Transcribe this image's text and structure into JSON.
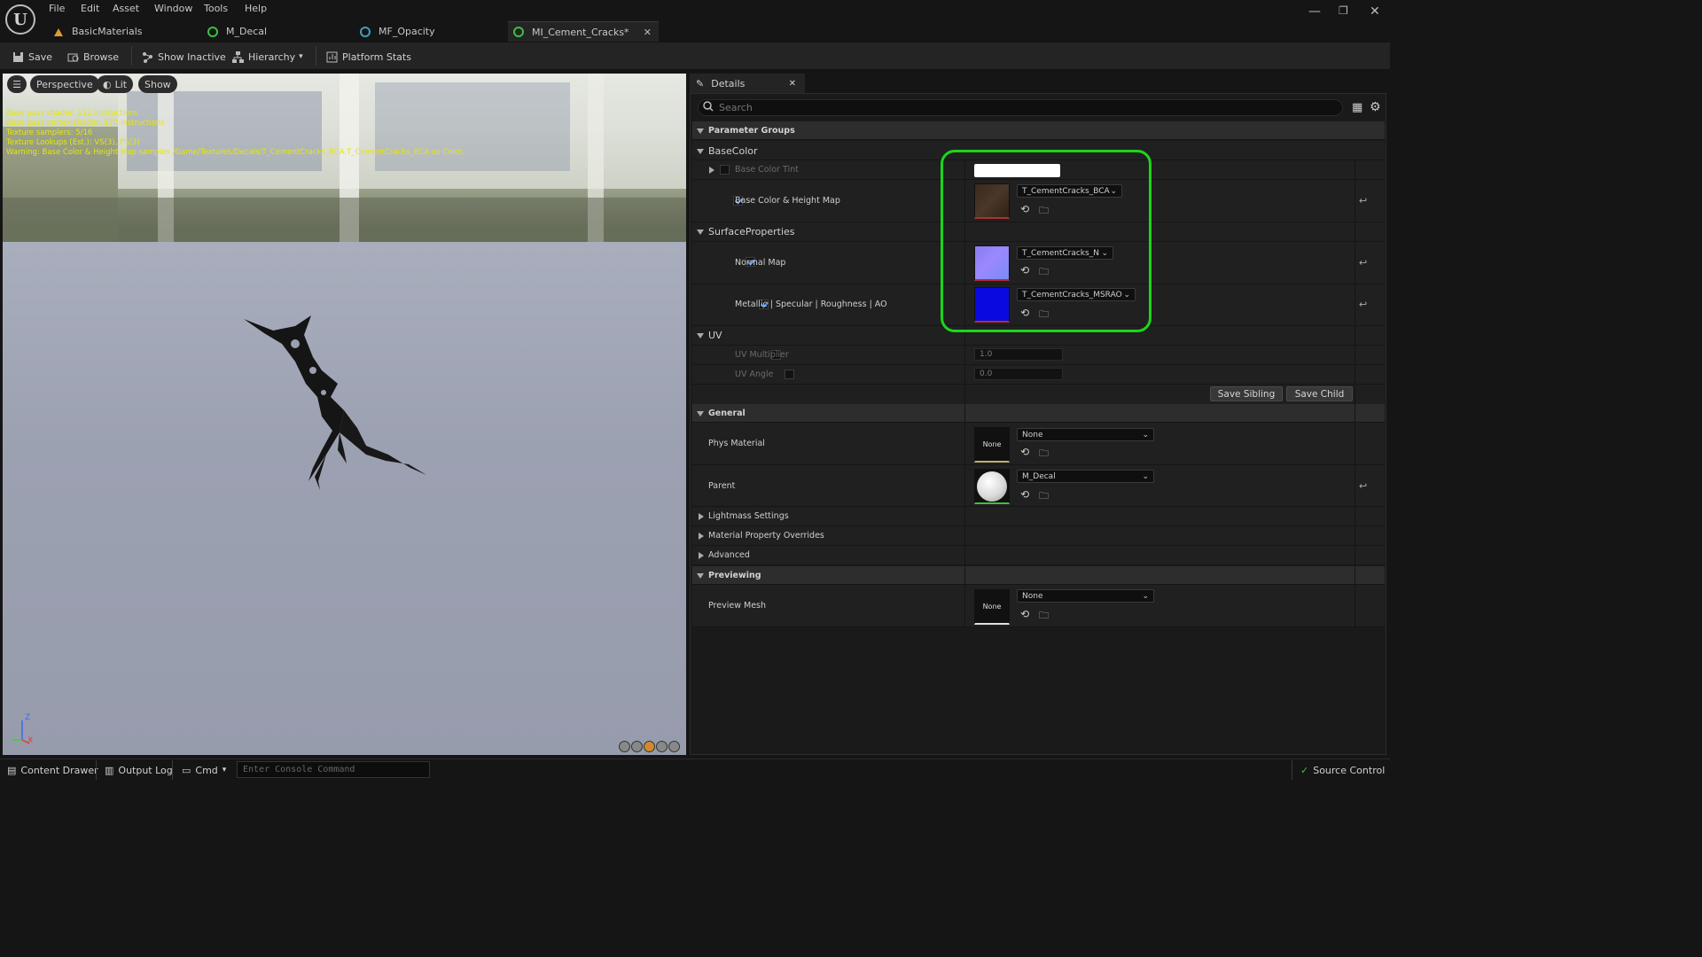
{
  "menu": [
    "File",
    "Edit",
    "Asset",
    "Window",
    "Tools",
    "Help"
  ],
  "tabs": [
    {
      "label": "BasicMaterials",
      "color": "#e09a2d"
    },
    {
      "label": "M_Decal",
      "color": "#3fbf3f"
    },
    {
      "label": "MF_Opacity",
      "color": "#3fa0bf"
    },
    {
      "label": "MI_Cement_Cracks*",
      "color": "#3fbf3f"
    }
  ],
  "toolbar": {
    "save": "Save",
    "browse": "Browse",
    "show_inactive": "Show Inactive",
    "hierarchy": "Hierarchy",
    "platform_stats": "Platform Stats"
  },
  "viewport": {
    "perspective": "Perspective",
    "lit": "Lit",
    "show": "Show",
    "stats": [
      "Base pass shader: 132 instructions",
      "Base pass vertex shader: 277 instructions",
      "Texture samplers: 5/16",
      "Texture Lookups (Est.): VS(3), PS(3)",
      "Warning: Base Color & Height Map samples /Game/Textures/Decals/T_CementCracks_BCA.T_CementCracks_BCA as Color."
    ],
    "axis_z": "Z",
    "axis_x": "X"
  },
  "details": {
    "tab": "Details",
    "search_placeholder": "Search",
    "parameter_groups": "Parameter Groups",
    "basecolor": {
      "title": "BaseColor",
      "tint_label": "Base Color Tint",
      "map_label": "Base Color & Height Map",
      "map_value": "T_CementCracks_BCA"
    },
    "surface": {
      "title": "SurfaceProperties",
      "normal_label": "Normal Map",
      "normal_value": "T_CementCracks_N",
      "msrao_label": "Metallic | Specular | Roughness | AO",
      "msrao_value": "T_CementCracks_MSRAO"
    },
    "uv": {
      "title": "UV",
      "mult_label": "UV Multiplier",
      "mult_value": "1.0",
      "angle_label": "UV Angle",
      "angle_value": "0.0"
    },
    "save_sibling": "Save Sibling",
    "save_child": "Save Child",
    "general": {
      "title": "General",
      "phys_label": "Phys Material",
      "phys_thumb": "None",
      "phys_value": "None",
      "parent_label": "Parent",
      "parent_value": "M_Decal"
    },
    "lightmass": "Lightmass Settings",
    "overrides": "Material Property Overrides",
    "advanced": "Advanced",
    "previewing": {
      "title": "Previewing",
      "mesh_label": "Preview Mesh",
      "mesh_thumb": "None",
      "mesh_value": "None"
    }
  },
  "statusbar": {
    "content_drawer": "Content Drawer",
    "output_log": "Output Log",
    "cmd": "Cmd",
    "console_placeholder": "Enter Console Command",
    "source_control": "Source Control"
  }
}
